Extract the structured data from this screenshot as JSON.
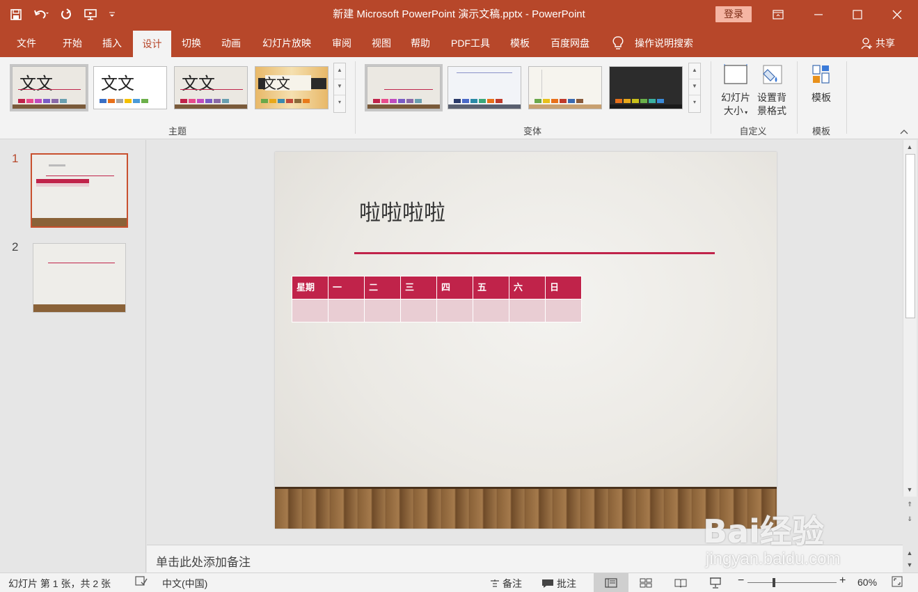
{
  "titlebar": {
    "doc_title": "新建 Microsoft PowerPoint 演示文稿.pptx  -  PowerPoint",
    "login": "登录"
  },
  "tabs": [
    "文件",
    "开始",
    "插入",
    "设计",
    "切换",
    "动画",
    "幻灯片放映",
    "审阅",
    "视图",
    "帮助",
    "PDF工具",
    "模板",
    "百度网盘"
  ],
  "active_tab": "设计",
  "tell_me": "操作说明搜索",
  "share": "共享",
  "ribbon": {
    "theme_sample_text": "文文",
    "theme_group": "主题",
    "variant_group": "变体",
    "customize_group": "自定义",
    "template_group": "模板",
    "slide_size_label_1": "幻灯片",
    "slide_size_label_2": "大小",
    "format_bg_label_1": "设置背",
    "format_bg_label_2": "景格式",
    "template_button": "模板"
  },
  "slides_pane": {
    "slide_numbers": [
      "1",
      "2"
    ]
  },
  "slide": {
    "title": "啦啦啦啦",
    "table_headers": [
      "星期",
      "一",
      "二",
      "三",
      "四",
      "五",
      "六",
      "日"
    ]
  },
  "notes_placeholder": "单击此处添加备注",
  "status": {
    "slide_info": "幻灯片 第 1 张，共 2 张",
    "language": "中文(中国)",
    "notes": "备注",
    "comments": "批注",
    "zoom": "60%"
  },
  "watermark": {
    "logo": "Bai经验",
    "url": "jingyan.baidu.com"
  },
  "colors": {
    "accent": "#b7472a",
    "table_header": "#c0234a",
    "table_body": "#e9cdd3"
  }
}
